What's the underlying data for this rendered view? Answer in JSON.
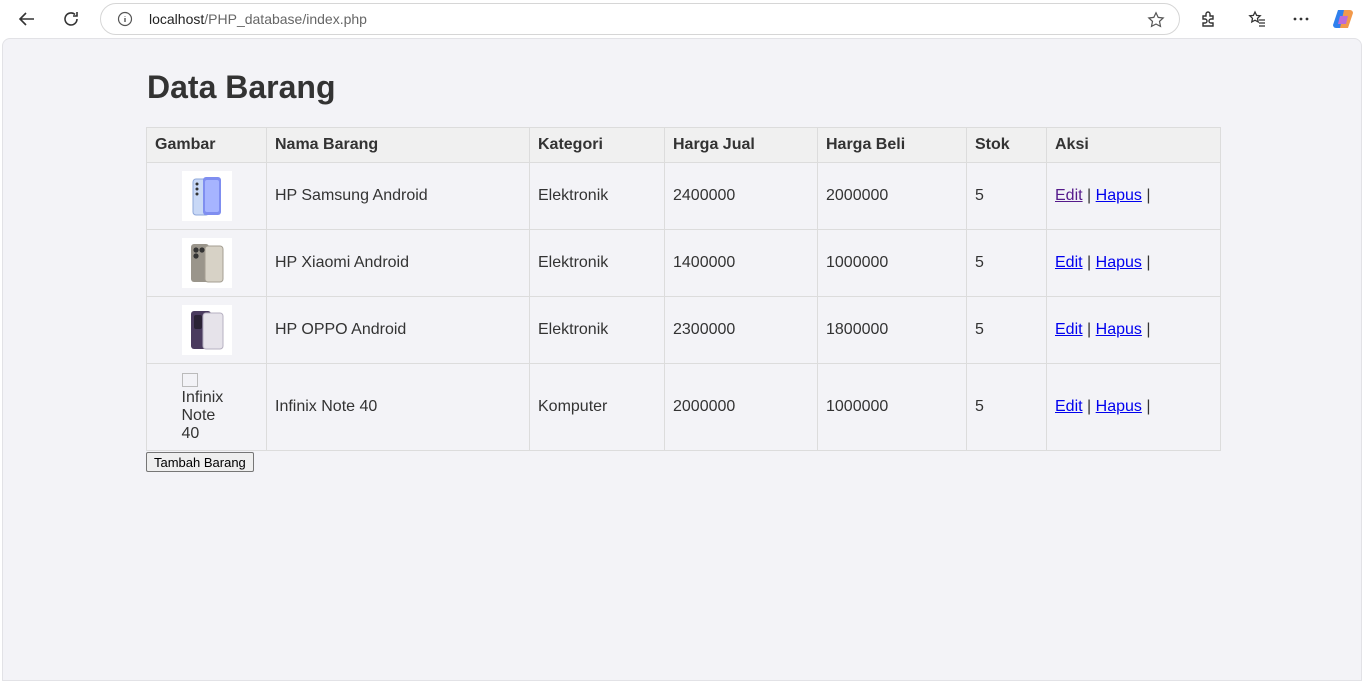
{
  "browser": {
    "url_host": "localhost",
    "url_path": "/PHP_database/index.php"
  },
  "page": {
    "title": "Data Barang",
    "add_button": "Tambah Barang"
  },
  "table": {
    "headers": [
      "Gambar",
      "Nama Barang",
      "Kategori",
      "Harga Jual",
      "Harga Beli",
      "Stok",
      "Aksi"
    ],
    "rows": [
      {
        "image_alt": "",
        "nama": "HP Samsung Android",
        "kategori": "Elektronik",
        "harga_jual": "2400000",
        "harga_beli": "2000000",
        "stok": "5",
        "edit": "Edit",
        "hapus": "Hapus",
        "sep": "|"
      },
      {
        "image_alt": "",
        "nama": "HP Xiaomi Android",
        "kategori": "Elektronik",
        "harga_jual": "1400000",
        "harga_beli": "1000000",
        "stok": "5",
        "edit": "Edit",
        "hapus": "Hapus",
        "sep": "|"
      },
      {
        "image_alt": "",
        "nama": "HP OPPO Android",
        "kategori": "Elektronik",
        "harga_jual": "2300000",
        "harga_beli": "1800000",
        "stok": "5",
        "edit": "Edit",
        "hapus": "Hapus",
        "sep": "|"
      },
      {
        "image_alt": "Infinix Note 40",
        "nama": "Infinix Note 40",
        "kategori": "Komputer",
        "harga_jual": "2000000",
        "harga_beli": "1000000",
        "stok": "5",
        "edit": "Edit",
        "hapus": "Hapus",
        "sep": "|"
      }
    ]
  }
}
